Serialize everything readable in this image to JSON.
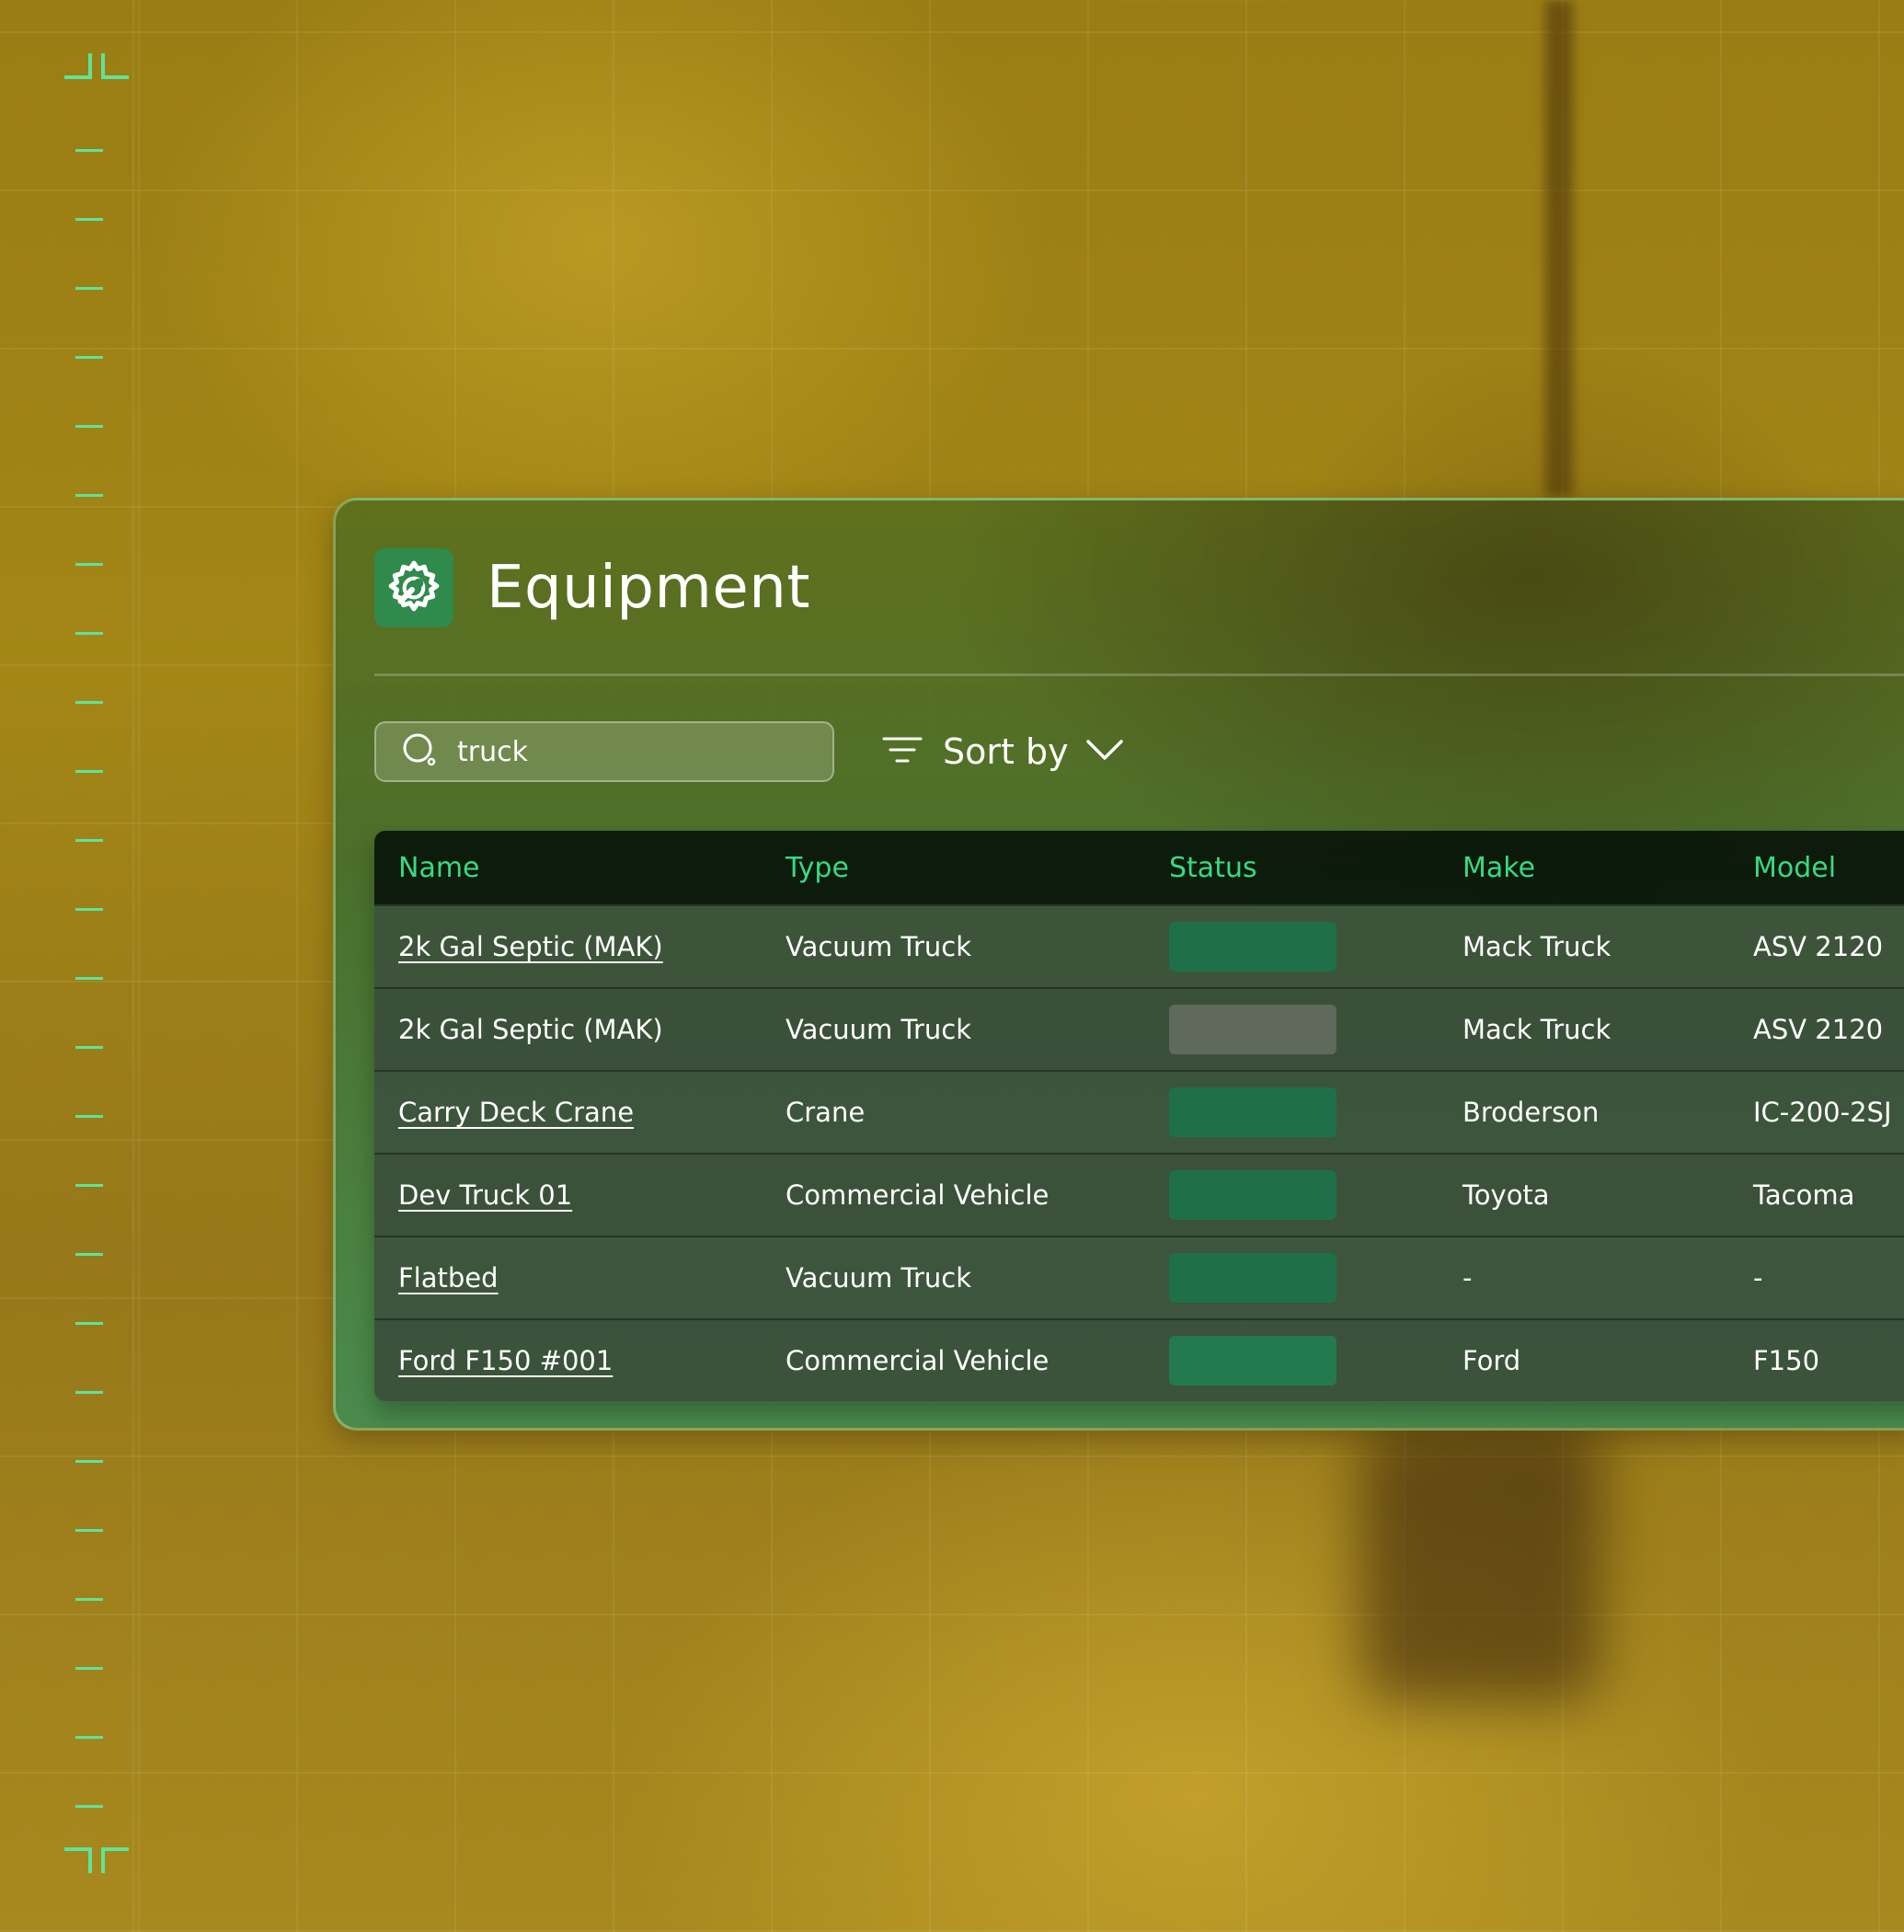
{
  "app": {
    "title": "Equipment",
    "icon": "gear-wrench-icon",
    "accent_color": "#39d982"
  },
  "search": {
    "value": "truck",
    "placeholder": ""
  },
  "sort": {
    "label": "Sort by"
  },
  "table": {
    "columns": [
      "Name",
      "Type",
      "Status",
      "Make",
      "Model"
    ],
    "rows": [
      {
        "name": "2k Gal Septic (MAK)",
        "linked": true,
        "type": "Vacuum Truck",
        "status_color": "#1f7048",
        "make": "Mack Truck",
        "model": "ASV 2120"
      },
      {
        "name": "2k Gal Septic (MAK)",
        "linked": false,
        "type": "Vacuum Truck",
        "status_color": "#5f6a5d",
        "make": "Mack Truck",
        "model": "ASV 2120"
      },
      {
        "name": "Carry Deck Crane",
        "linked": true,
        "type": "Crane",
        "status_color": "#1f7048",
        "make": "Broderson",
        "model": "IC-200-2SJ"
      },
      {
        "name": "Dev Truck 01",
        "linked": true,
        "type": "Commercial Vehicle",
        "status_color": "#1f7048",
        "make": "Toyota",
        "model": "Tacoma"
      },
      {
        "name": "Flatbed",
        "linked": true,
        "type": "Vacuum Truck",
        "status_color": "#1f7048",
        "make": "-",
        "model": "-"
      },
      {
        "name": "Ford F150 #001",
        "linked": true,
        "type": "Commercial Vehicle",
        "status_color": "#237a4e",
        "make": "Ford",
        "model": "F150"
      }
    ]
  }
}
